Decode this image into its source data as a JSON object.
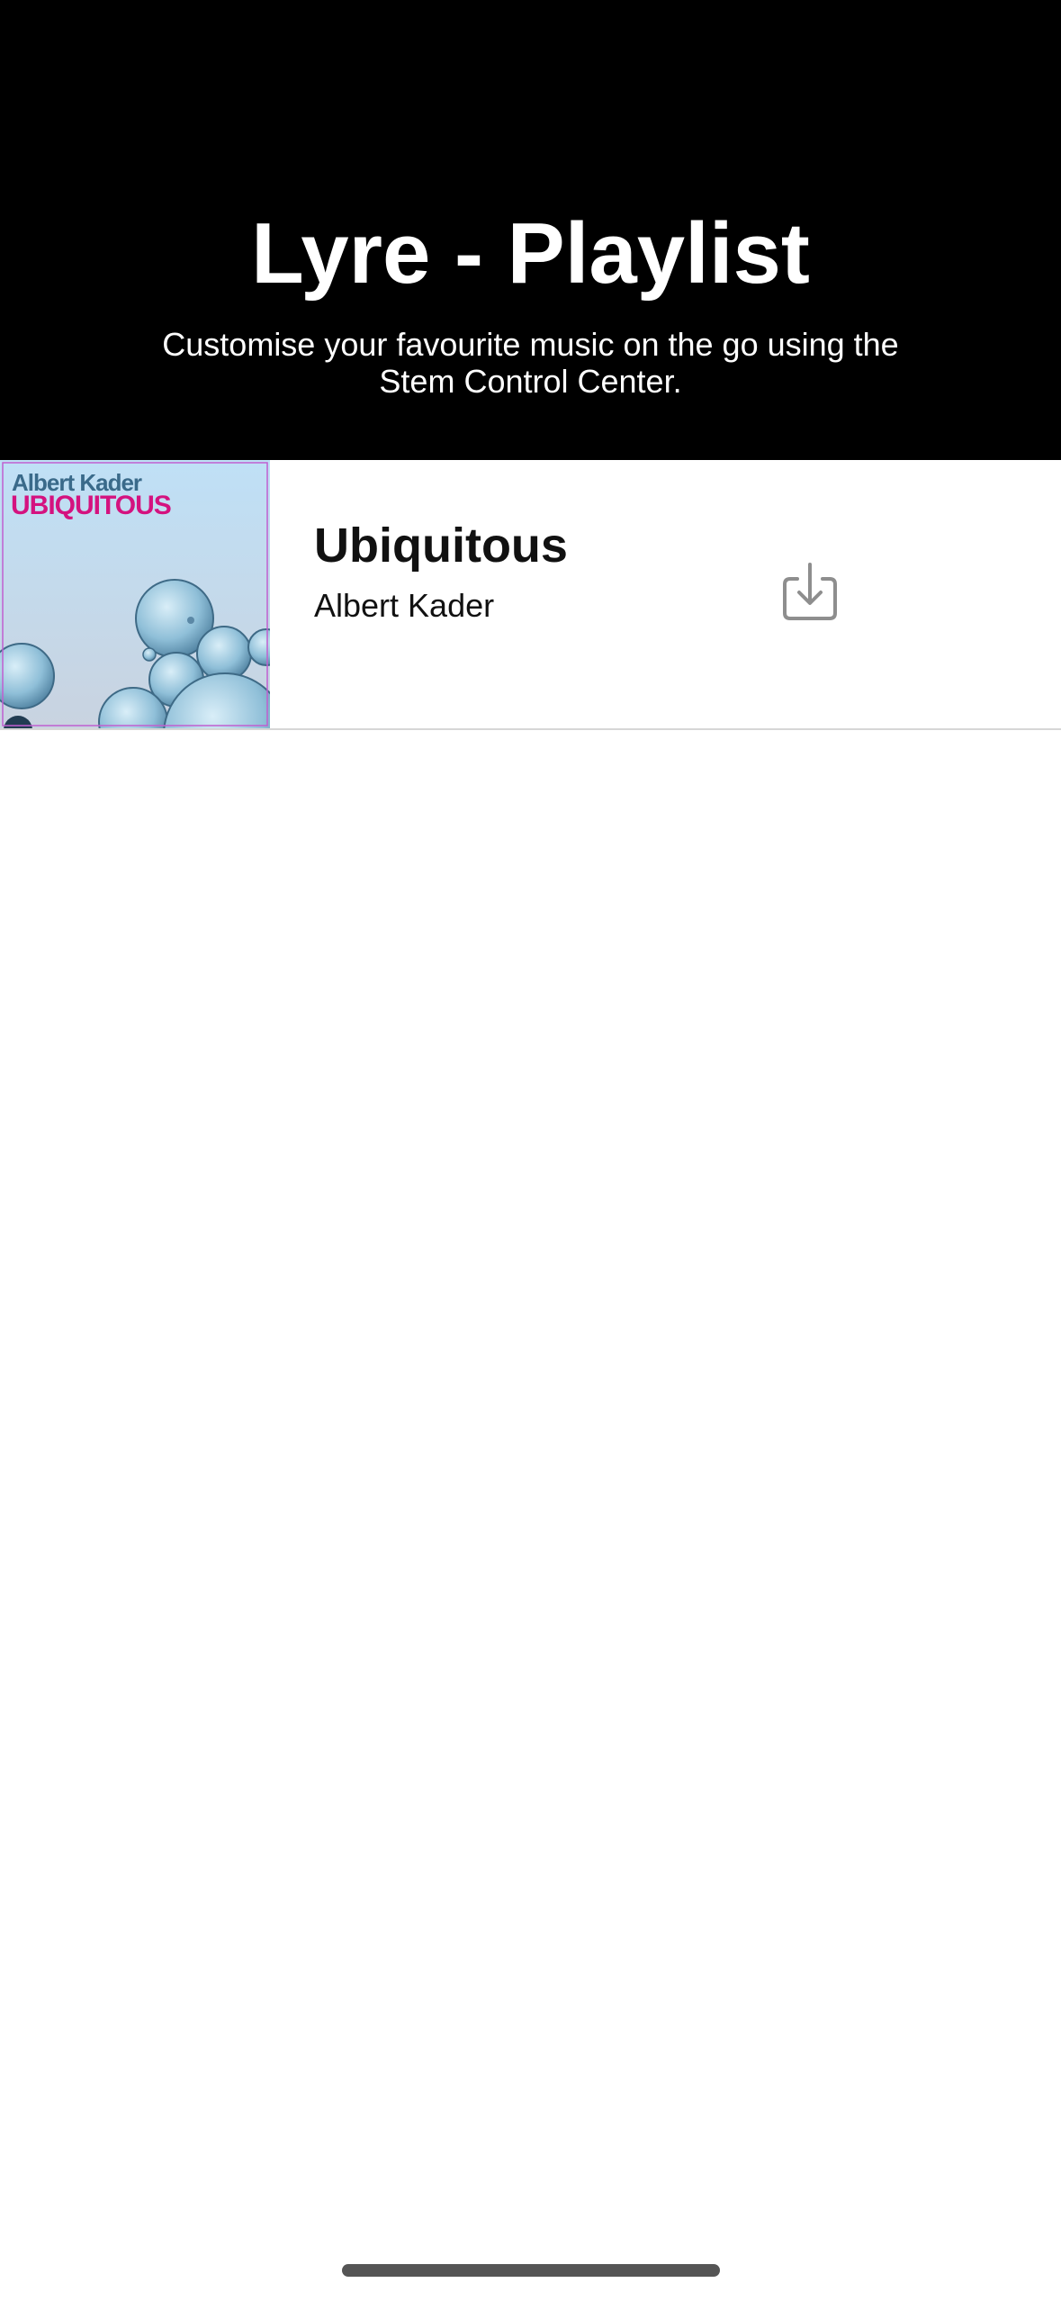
{
  "header": {
    "title": "Lyre - Playlist",
    "subtitle": "Customise your favourite music on the go using the Stem Control Center."
  },
  "playlist": [
    {
      "title": "Ubiquitous",
      "artist": "Albert Kader",
      "cover": {
        "artist_text": "Albert Kader",
        "album_text": "UBIQUITOUS"
      },
      "action_icon": "download-icon"
    }
  ],
  "colors": {
    "header_background": "#000000",
    "header_text": "#ffffff",
    "cover_album_text": "#d4127f",
    "cover_artist_text": "#3a6a8a",
    "icon_stroke": "#8e8e8e"
  }
}
